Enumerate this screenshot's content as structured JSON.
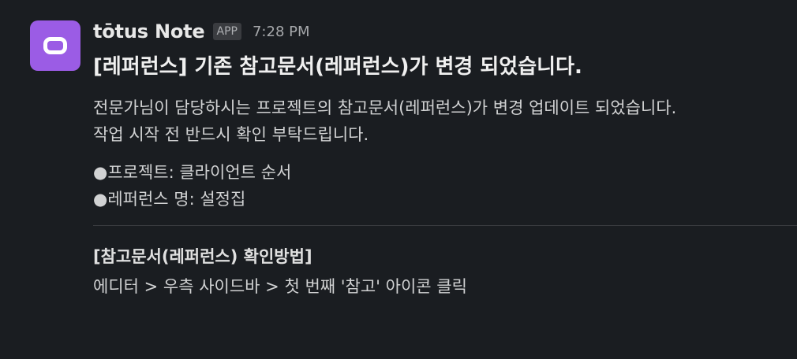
{
  "message": {
    "sender": "tōtus Note",
    "badge": "APP",
    "timestamp": "7:28 PM",
    "title": "[레퍼런스] 기존 참고문서(레퍼런스)가 변경 되었습니다.",
    "body": [
      "전문가님이 담당하시는 프로젝트의 참고문서(레퍼런스)가 변경 업데이트 되었습니다.",
      "작업 시작 전 반드시 확인 부탁드립니다."
    ],
    "bullets": [
      "●프로젝트: 클라이언트 순서",
      "●레퍼런스 명: 설정집"
    ],
    "section": {
      "title": "[참고문서(레퍼런스) 확인방법]",
      "text": "에디터 > 우측 사이드바 > 첫 번째 '참고' 아이콘 클릭"
    }
  },
  "colors": {
    "background": "#1a1d21",
    "avatar": "#9b5ce5",
    "badge_bg": "#3a3c40"
  },
  "avatar_icon": "app-logo-icon"
}
